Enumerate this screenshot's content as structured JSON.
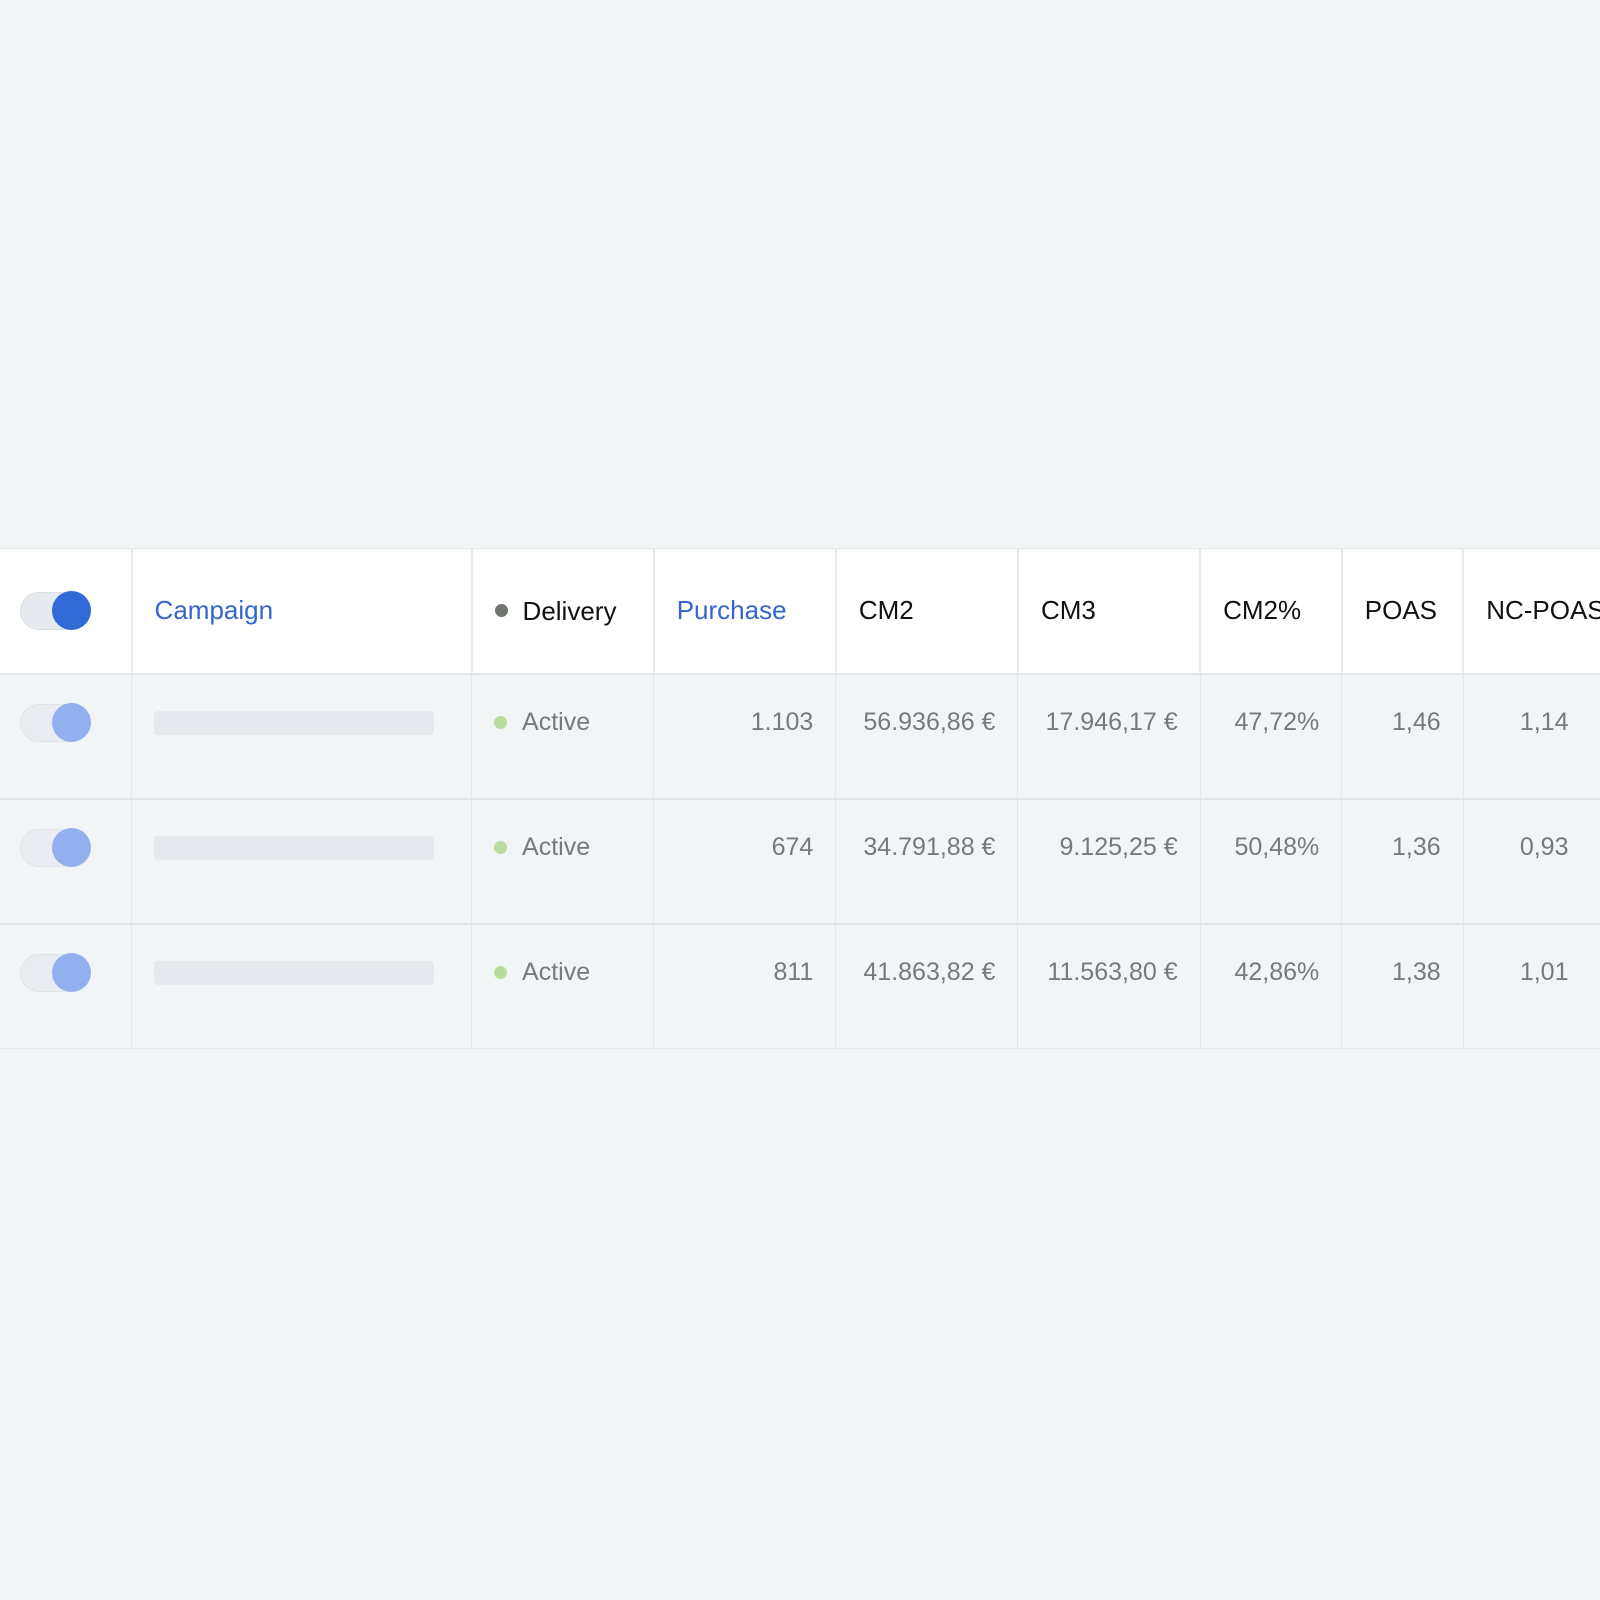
{
  "colors": {
    "link": "#3366cc",
    "toggle_on": "#2f6ad6",
    "toggle_row": "#92b0ef",
    "active_dot": "#b7dc9c",
    "delivery_dot": "#6f746c",
    "background": "#f2f5f6"
  },
  "header": {
    "campaign": "Campaign",
    "delivery": "Delivery",
    "purchase": "Purchase",
    "cm2": "CM2",
    "cm3": "CM3",
    "cm2_pct": "CM2%",
    "poas": "POAS",
    "nc_poas": "NC-POAS"
  },
  "rows": [
    {
      "toggle_on": true,
      "status": "Active",
      "purchase": "1.103",
      "cm2": "56.936,86 €",
      "cm3": "17.946,17 €",
      "cm2_pct": "47,72%",
      "poas": "1,46",
      "nc_poas": "1,14"
    },
    {
      "toggle_on": true,
      "status": "Active",
      "purchase": "674",
      "cm2": "34.791,88 €",
      "cm3": "9.125,25 €",
      "cm2_pct": "50,48%",
      "poas": "1,36",
      "nc_poas": "0,93"
    },
    {
      "toggle_on": true,
      "status": "Active",
      "purchase": "811",
      "cm2": "41.863,82 €",
      "cm3": "11.563,80 €",
      "cm2_pct": "42,86%",
      "poas": "1,38",
      "nc_poas": "1,01"
    }
  ]
}
